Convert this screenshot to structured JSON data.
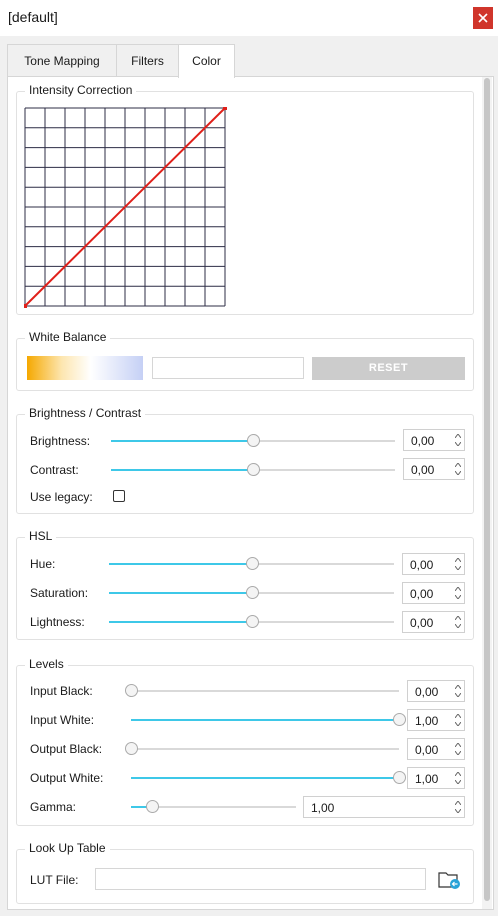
{
  "window": {
    "title": "[default]"
  },
  "tabs": [
    {
      "label": "Tone Mapping",
      "active": false
    },
    {
      "label": "Filters",
      "active": false
    },
    {
      "label": "Color",
      "active": true
    }
  ],
  "intensity_correction": {
    "title": "Intensity Correction",
    "curve_points": [
      [
        0,
        0
      ],
      [
        1,
        1
      ]
    ],
    "curve_color": "#e0201a"
  },
  "white_balance": {
    "title": "White Balance",
    "reset_label": "RESET"
  },
  "brightness_contrast": {
    "title": "Brightness / Contrast",
    "brightness": {
      "label": "Brightness:",
      "value": "0,00",
      "level": 0.5
    },
    "contrast": {
      "label": "Contrast:",
      "value": "0,00",
      "level": 0.5
    },
    "use_legacy": {
      "label": "Use legacy:",
      "checked": false
    }
  },
  "hsl": {
    "title": "HSL",
    "hue": {
      "label": "Hue:",
      "value": "0,00",
      "level": 0.5
    },
    "saturation": {
      "label": "Saturation:",
      "value": "0,00",
      "level": 0.5
    },
    "lightness": {
      "label": "Lightness:",
      "value": "0,00",
      "level": 0.5
    }
  },
  "levels": {
    "title": "Levels",
    "input_black": {
      "label": "Input Black:",
      "value": "0,00",
      "level": 0.0
    },
    "input_white": {
      "label": "Input White:",
      "value": "1,00",
      "level": 1.0
    },
    "output_black": {
      "label": "Output Black:",
      "value": "0,00",
      "level": 0.0
    },
    "output_white": {
      "label": "Output White:",
      "value": "1,00",
      "level": 1.0
    },
    "gamma": {
      "label": "Gamma:",
      "value": "1,00",
      "level": 0.13
    }
  },
  "lut": {
    "title": "Look Up Table",
    "file_label": "LUT File:",
    "file_value": ""
  },
  "colors": {
    "accent": "#3ec8e8",
    "close": "#d0352b",
    "track_inactive": "#d9d9d9"
  },
  "icons": {
    "close": "close-icon",
    "folder": "folder-open-icon",
    "spin_up": "chevron-up-icon",
    "spin_down": "chevron-down-icon"
  }
}
